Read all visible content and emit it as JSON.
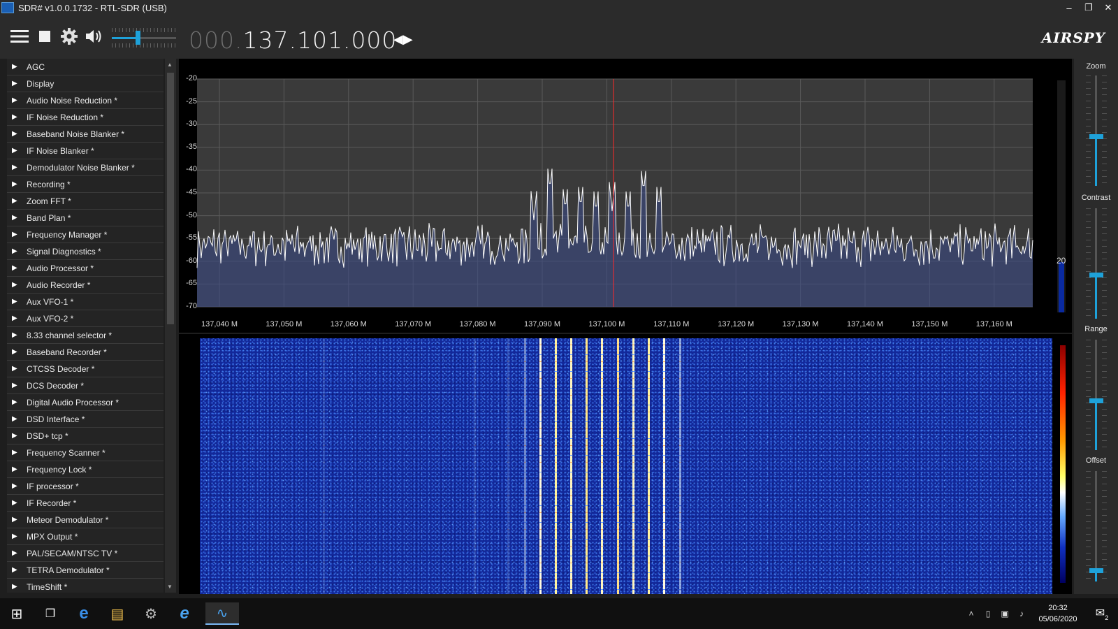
{
  "window": {
    "title": "SDR# v1.0.0.1732 - RTL-SDR (USB)",
    "minimize_glyph": "–",
    "restore_glyph": "❐",
    "close_glyph": "✕"
  },
  "toolbar": {
    "frequency_dim": "000.",
    "frequency_main": "137.101.000",
    "tune_arrows": "◀▶",
    "logo": "AIRSPY",
    "volume_level": 0.4
  },
  "plugins": [
    "AGC",
    "Display",
    "Audio Noise Reduction *",
    "IF Noise Reduction *",
    "Baseband Noise Blanker *",
    "IF Noise Blanker *",
    "Demodulator Noise Blanker *",
    "Recording *",
    "Zoom FFT *",
    "Band Plan *",
    "Frequency Manager *",
    "Signal Diagnostics *",
    "Audio Processor *",
    "Audio Recorder *",
    "Aux VFO-1 *",
    "Aux VFO-2 *",
    "8.33 channel selector *",
    "Baseband Recorder *",
    "CTCSS Decoder *",
    "DCS Decoder *",
    "Digital Audio Processor *",
    "DSD Interface *",
    "DSD+ tcp *",
    "Frequency Scanner *",
    "Frequency Lock *",
    "IF processor *",
    "IF Recorder *",
    "Meteor Demodulator *",
    "MPX Output *",
    "PAL/SECAM/NTSC TV *",
    "TETRA Demodulator *",
    "TimeShift *"
  ],
  "spectrum": {
    "y_ticks": [
      "-20",
      "-25",
      "-30",
      "-35",
      "-40",
      "-45",
      "-50",
      "-55",
      "-60",
      "-65",
      "-70"
    ],
    "x_ticks": [
      "137,040 M",
      "137,050 M",
      "137,060 M",
      "137,070 M",
      "137,080 M",
      "137,090 M",
      "137,100 M",
      "137,110 M",
      "137,120 M",
      "137,130 M",
      "137,140 M",
      "137,150 M",
      "137,160 M"
    ],
    "side_value": "20",
    "colors": {
      "background": "#3a3a3a",
      "grid": "#5a5a5a",
      "trace": "#ffffff",
      "fill": "#3a4a8a",
      "marker": "#ff2a2a"
    }
  },
  "right_panel": {
    "zoom_label": "Zoom",
    "contrast_label": "Contrast",
    "range_label": "Range",
    "offset_label": "Offset",
    "zoom_level": 0.45,
    "contrast_level": 0.4,
    "range_level": 0.45,
    "offset_level": 0.1
  },
  "taskbar": {
    "start_icon": "⊞",
    "taskview_icon": "❐",
    "edge_icon": "e",
    "explorer_icon": "▤",
    "control_icon": "⚙",
    "ie_icon": "e",
    "sdr_icon": "∿",
    "tray_chevron": "˄",
    "tray_usb": "▯",
    "tray_network": "▣",
    "tray_volume": "♪",
    "time": "20:32",
    "date": "05/06/2020",
    "notification_icon": "✉",
    "notification_count": "2"
  }
}
